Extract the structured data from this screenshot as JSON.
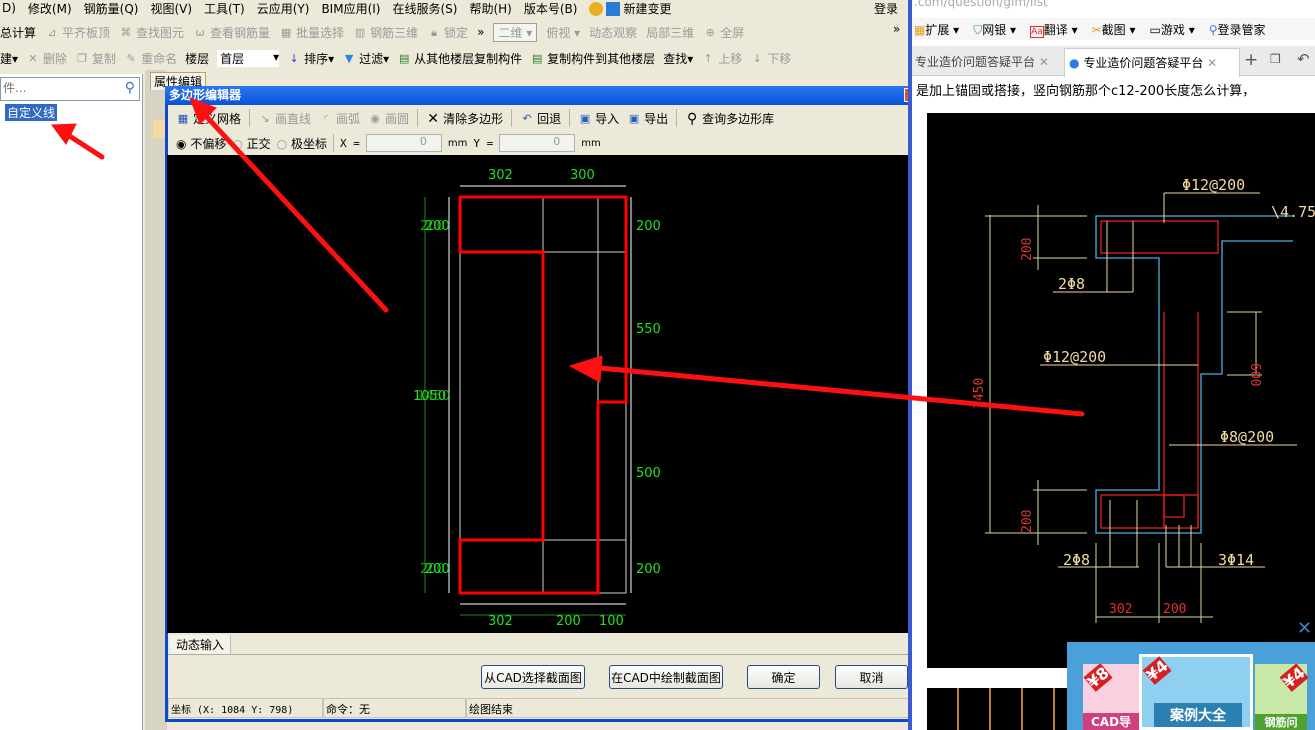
{
  "menu": [
    "D)",
    "修改(M)",
    "钢筋量(Q)",
    "视图(V)",
    "工具(T)",
    "云应用(Y)",
    "BIM应用(I)",
    "在线服务(S)",
    "帮助(H)",
    "版本号(B)",
    "新建变更"
  ],
  "login": "登录",
  "toolbar1": [
    "总计算",
    "平齐板顶",
    "查找图元",
    "查看钢筋量",
    "批量选择",
    "钢筋三维",
    "锁定",
    "»",
    "二维",
    "俯视",
    "动态观察",
    "局部三维",
    "全屏",
    "»"
  ],
  "toolbar2": {
    "new": "建▾",
    "delete": "删除",
    "copy": "复制",
    "rename": "重命名",
    "floor_label": "楼层",
    "floor_value": "首层",
    "sort": "排序▾",
    "filter": "过滤▾",
    "copy_from": "从其他楼层复制构件",
    "copy_to": "复制构件到其他楼层",
    "find": "查找▾",
    "up": "上移",
    "down": "下移"
  },
  "left": {
    "search_placeholder": "件...",
    "tree_item": "自定义线"
  },
  "mid_tab": "属性编辑",
  "dialog": {
    "title": "多边形编辑器",
    "tools": {
      "grid": "定义网格",
      "line": "画直线",
      "arc": "画弧",
      "circle": "画圆",
      "clear": "清除多边形",
      "undo": "回退",
      "import": "导入",
      "export": "导出",
      "library": "查询多边形库"
    },
    "modes": [
      "不偏移",
      "正交",
      "极坐标"
    ],
    "x_label": "X =",
    "x_value": "0",
    "y_label": "Y =",
    "y_value": "0",
    "unit": "mm",
    "dims": {
      "top": [
        "302",
        "300"
      ],
      "bottom": [
        "302",
        "200",
        "100"
      ],
      "right": [
        "200",
        "550",
        "500",
        "200"
      ],
      "left": [
        "200",
        "1050",
        "200"
      ],
      "left_overlap": [
        "200",
        "1450",
        "200"
      ]
    },
    "dynamic_tab": "动态输入",
    "buttons": {
      "from_cad": "从CAD选择截面图",
      "draw_cad": "在CAD中绘制截面图",
      "ok": "确定",
      "cancel": "取消"
    },
    "status": {
      "coords": "坐标 (X: 1084 Y: 798)",
      "command": "命令：无",
      "message": "绘图结束"
    }
  },
  "browser": {
    "address": ".com/question/gim/list",
    "toolbar": [
      "扩展",
      "网银",
      "翻译",
      "截图",
      "游戏",
      "登录管家"
    ],
    "tabs": [
      "专业造价问题答疑平台",
      "专业造价问题答疑平台"
    ],
    "text": "是加上锚固或搭接，竖向钢筋那个c12-200长度怎么计算，",
    "cad_labels": {
      "t1": "Φ12@200",
      "t2": "\\4.75",
      "t3": "200",
      "t4": "2Φ8",
      "t5": "Φ12@200",
      "t6": "600",
      "t7": "1450",
      "t8": "Φ8@200",
      "t9": "200",
      "t10": "2Φ8",
      "t11": "3Φ14",
      "t12": "302",
      "t13": "200"
    },
    "ads": {
      "price1": "¥8",
      "price2": "¥4",
      "price3": "¥4",
      "label1": "CAD导",
      "label2": "案例大全",
      "label3": "钢筋问"
    }
  },
  "colors": {
    "titlebar": "#0a5ce0",
    "polygon": "#ff0000",
    "dims": "#22e022",
    "arrow": "#ff1010"
  }
}
